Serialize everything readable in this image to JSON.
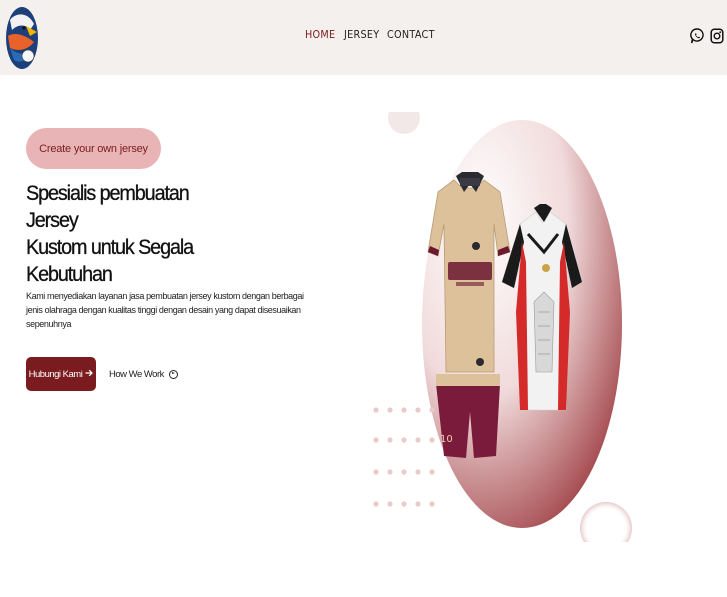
{
  "header": {
    "logo_icon": "eagle-logo-icon",
    "nav": [
      {
        "label": "HOME",
        "active": true
      },
      {
        "label": "JERSEY",
        "active": false
      },
      {
        "label": "CONTACT",
        "active": false
      }
    ],
    "social": [
      {
        "icon": "whatsapp-icon"
      },
      {
        "icon": "instagram-icon"
      }
    ]
  },
  "hero": {
    "badge": "Create your own jersey",
    "title_line1": "Spesialis pembuatan Jersey",
    "title_line2": "Kustom untuk Segala",
    "title_line3": "Kebutuhan",
    "description": "Kami menyediakan layanan jasa pembuatan jersey kustom dengan berbagai jenis olahraga dengan kualitas tinggi dengan desain yang dapat disesuaikan sepenuhnya",
    "primary_button": "Hubungi Kami",
    "primary_button_icon": "arrow-right-icon",
    "secondary_button": "How We Work",
    "secondary_button_icon": "play-circle-icon"
  },
  "colors": {
    "accent": "#7a1b1f",
    "badge_bg": "#e9b4b5",
    "header_bg": "#f4f0ee"
  }
}
